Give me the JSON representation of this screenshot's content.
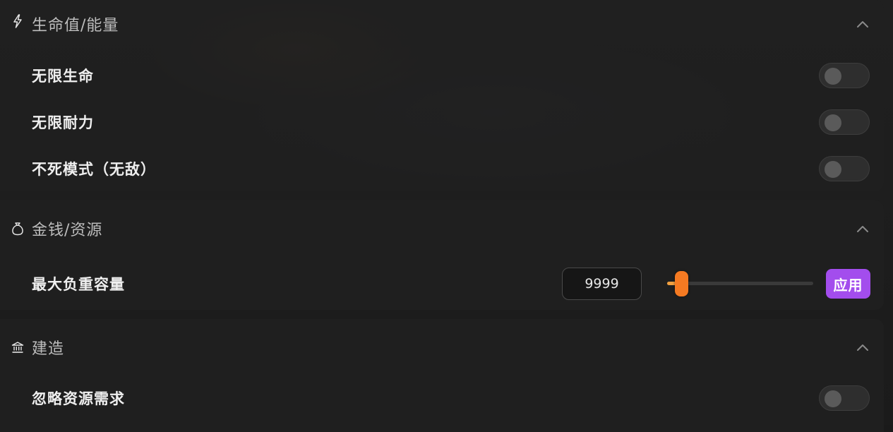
{
  "sections": {
    "health": {
      "icon": "lightning-icon",
      "title": "生命值/能量",
      "expanded": true,
      "items": [
        {
          "label": "无限生命",
          "enabled": false
        },
        {
          "label": "无限耐力",
          "enabled": false
        },
        {
          "label": "不死模式（无敌）",
          "enabled": false
        }
      ]
    },
    "money": {
      "icon": "money-bag-icon",
      "title": "金钱/资源",
      "expanded": true,
      "max_weight": {
        "label": "最大负重容量",
        "value": "9999",
        "slider_fraction": 0.1,
        "apply_label": "应用"
      }
    },
    "build": {
      "icon": "building-icon",
      "title": "建造",
      "expanded": true,
      "items": [
        {
          "label": "忽略资源需求",
          "enabled": false
        }
      ]
    }
  },
  "colors": {
    "accent_orange": "#f57a22",
    "apply_purple": "#a34ded"
  }
}
